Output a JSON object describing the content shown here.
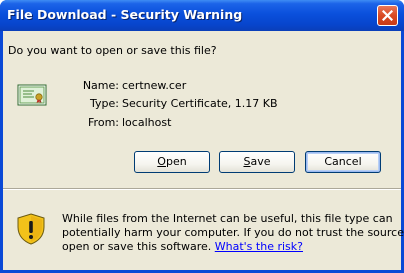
{
  "window": {
    "title": "File Download - Security Warning",
    "close_label": "Close"
  },
  "prompt": {
    "question": "Do you want to open or save this file?"
  },
  "file": {
    "icon": "certificate-icon",
    "name_label": "Name:",
    "name_value": "certnew.cer",
    "type_label": "Type:",
    "type_value": "Security Certificate, 1.17 KB",
    "from_label": "From:",
    "from_value": "localhost"
  },
  "buttons": {
    "open_rest": "pen",
    "open_accel": "O",
    "save_rest": "ave",
    "save_accel": "S",
    "cancel": "Cancel"
  },
  "warning": {
    "icon": "warning-shield-icon",
    "line1": "While files from the Internet can be useful, this file type can",
    "line2": "potentially harm your computer. If you do not trust the source, do not",
    "line3_prefix": "open or save this software. ",
    "risk_link": "What's the risk?"
  },
  "colors": {
    "titlebar": "#0a50dc",
    "dialog_background": "#ece9d8",
    "close_button": "#d94a23",
    "link": "#0000ff"
  }
}
